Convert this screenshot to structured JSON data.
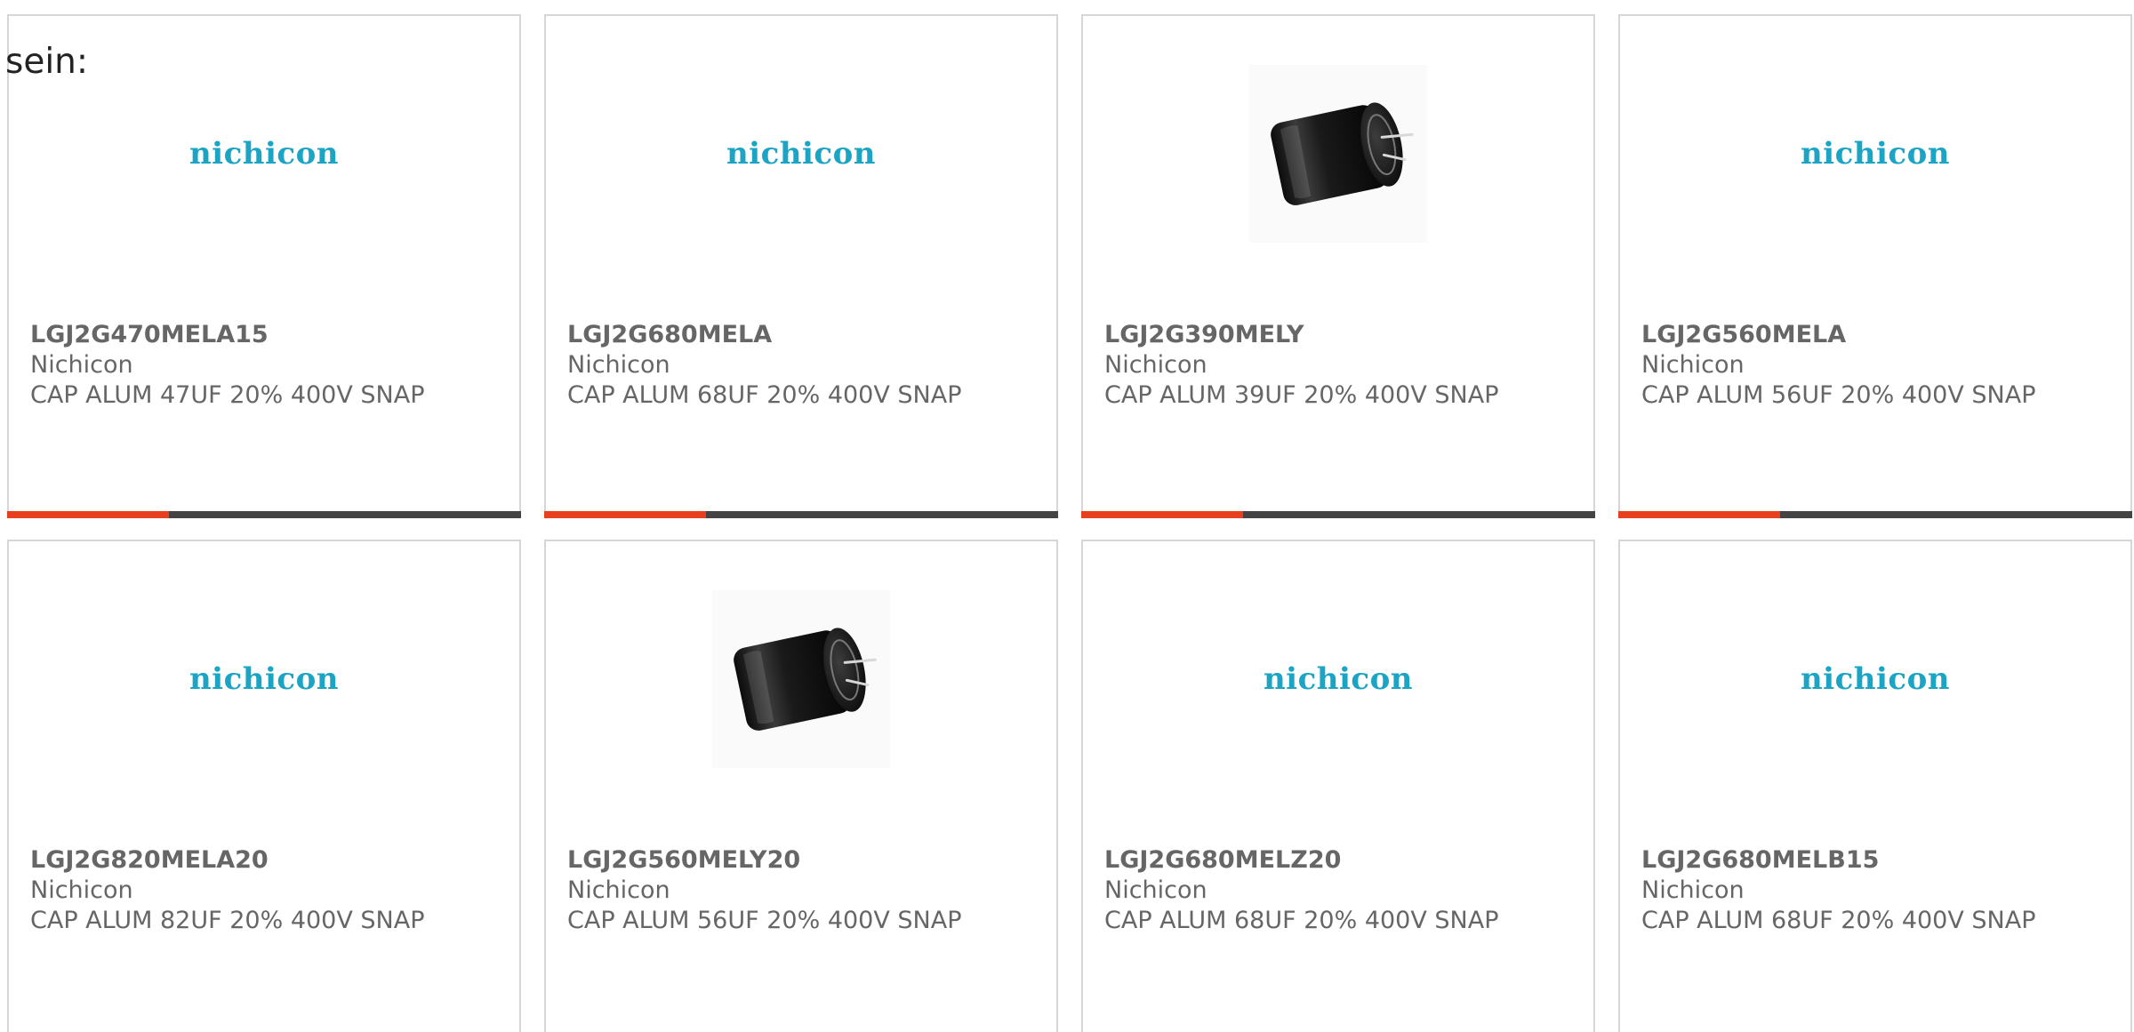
{
  "intro": {
    "text": "sein:"
  },
  "colors": {
    "logo": "#1ba4c4",
    "accent_progress": "#e8401f",
    "progress_track": "#444444",
    "card_border": "#d6d6d6",
    "text": "#666666"
  },
  "products": [
    {
      "part_number": "LGJ2G470MELA15",
      "manufacturer": "Nichicon",
      "description": "CAP ALUM 47UF 20% 400V SNAP",
      "image_type": "logo",
      "logo_text": "nichicon",
      "progress_fraction": 0.315
    },
    {
      "part_number": "LGJ2G680MELA",
      "manufacturer": "Nichicon",
      "description": "CAP ALUM 68UF 20% 400V SNAP",
      "image_type": "logo",
      "logo_text": "nichicon",
      "progress_fraction": 0.315
    },
    {
      "part_number": "LGJ2G390MELY",
      "manufacturer": "Nichicon",
      "description": "CAP ALUM 39UF 20% 400V SNAP",
      "image_type": "photo",
      "logo_text": "",
      "progress_fraction": 0.315
    },
    {
      "part_number": "LGJ2G560MELA",
      "manufacturer": "Nichicon",
      "description": "CAP ALUM 56UF 20% 400V SNAP",
      "image_type": "logo",
      "logo_text": "nichicon",
      "progress_fraction": 0.315
    },
    {
      "part_number": "LGJ2G820MELA20",
      "manufacturer": "Nichicon",
      "description": "CAP ALUM 82UF 20% 400V SNAP",
      "image_type": "logo",
      "logo_text": "nichicon",
      "progress_fraction": null
    },
    {
      "part_number": "LGJ2G560MELY20",
      "manufacturer": "Nichicon",
      "description": "CAP ALUM 56UF 20% 400V SNAP",
      "image_type": "photo",
      "logo_text": "",
      "progress_fraction": null
    },
    {
      "part_number": "LGJ2G680MELZ20",
      "manufacturer": "Nichicon",
      "description": "CAP ALUM 68UF 20% 400V SNAP",
      "image_type": "logo",
      "logo_text": "nichicon",
      "progress_fraction": null
    },
    {
      "part_number": "LGJ2G680MELB15",
      "manufacturer": "Nichicon",
      "description": "CAP ALUM 68UF 20% 400V SNAP",
      "image_type": "logo",
      "logo_text": "nichicon",
      "progress_fraction": null
    }
  ]
}
